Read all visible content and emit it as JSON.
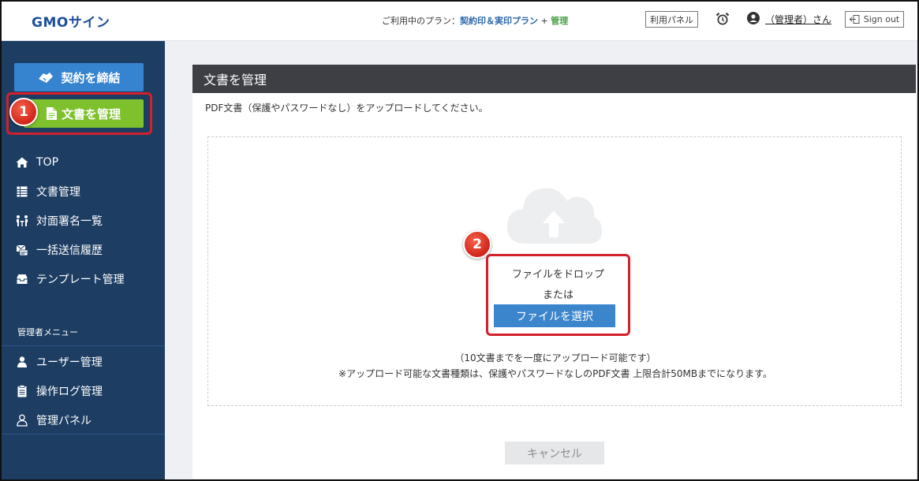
{
  "header": {
    "logo": "GMOサイン",
    "plan_prefix": "ご利用中のプラン：",
    "plan_name": "契約印＆実印プラン",
    "plan_plus": " + ",
    "plan_suffix": "管理",
    "panel_label": "利用パネル",
    "user_label": "（管理者）さん",
    "signout_label": "Sign out"
  },
  "sidebar": {
    "contract_label": "契約を締結",
    "manage_label": "文書を管理",
    "badge_1": "1",
    "items": [
      {
        "label": "TOP",
        "icon": "home-icon"
      },
      {
        "label": "文書管理",
        "icon": "table-icon"
      },
      {
        "label": "対面署名一覧",
        "icon": "face-to-face-icon"
      },
      {
        "label": "一括送信履歴",
        "icon": "bulk-send-icon"
      },
      {
        "label": "テンプレート管理",
        "icon": "template-icon"
      }
    ],
    "admin_title": "管理者メニュー",
    "admin_items": [
      {
        "label": "ユーザー管理",
        "icon": "user-icon"
      },
      {
        "label": "操作ログ管理",
        "icon": "clipboard-icon"
      },
      {
        "label": "管理パネル",
        "icon": "admin-user-icon"
      }
    ]
  },
  "main": {
    "title": "文書を管理",
    "intro": "PDF文書（保護やパスワードなし）をアップロードしてください。",
    "badge_2": "2",
    "drop_text": "ファイルをドロップ",
    "or_text": "または",
    "select_label": "ファイルを選択",
    "note_1": "（10文書までを一度にアップロード可能です）",
    "note_2": "※アップロード可能な文書種類は、保護やパスワードなしのPDF文書 上限合計50MBまでになります。",
    "cancel_label": "キャンセル"
  },
  "colors": {
    "sidebar_bg": "#1d3d63",
    "contract_btn": "#3683cf",
    "manage_btn": "#7ec12c",
    "highlight": "#d3202a",
    "select_btn": "#3b85cd"
  }
}
